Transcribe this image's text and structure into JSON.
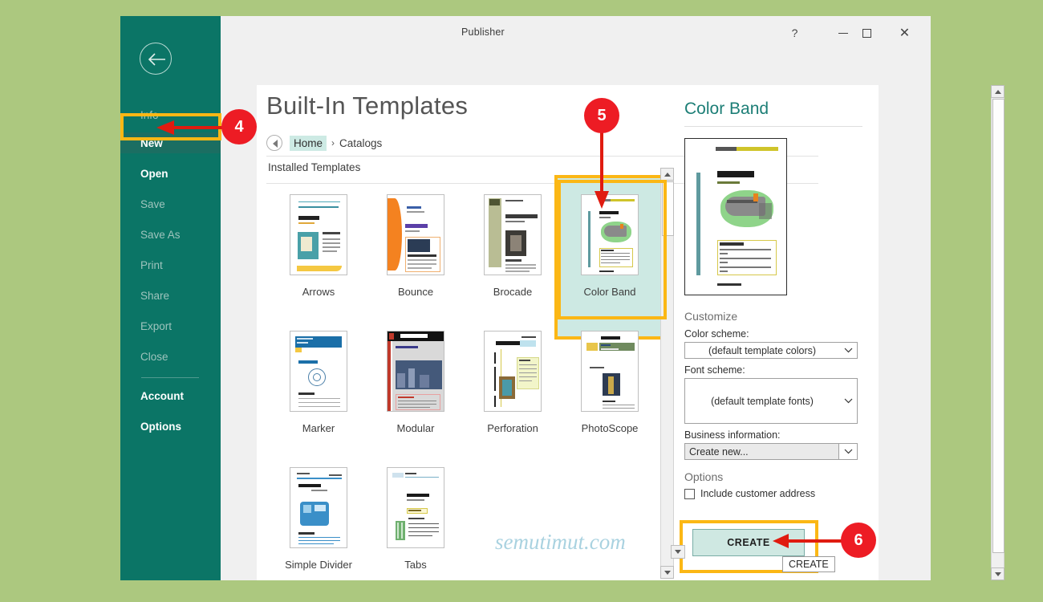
{
  "app": {
    "title": "Publisher",
    "background_color": "#acc87f",
    "accent_teal": "#0b7566",
    "highlight_yellow": "#fbb715",
    "callout_red": "#ed1c24"
  },
  "titlebar": {
    "title": "Publisher",
    "help_glyph": "?",
    "minimize_label": "minimize",
    "maximize_label": "maximize",
    "close_glyph": "✕"
  },
  "sidebar": {
    "back_label": "Back",
    "items": [
      {
        "label": "Info",
        "state": "dim"
      },
      {
        "label": "New",
        "state": "active"
      },
      {
        "label": "Open",
        "state": "bold"
      },
      {
        "label": "Save",
        "state": "dim"
      },
      {
        "label": "Save As",
        "state": "dim"
      },
      {
        "label": "Print",
        "state": "dim"
      },
      {
        "label": "Share",
        "state": "dim"
      },
      {
        "label": "Export",
        "state": "dim"
      },
      {
        "label": "Close",
        "state": "dim"
      },
      {
        "label": "Account",
        "state": "bold"
      },
      {
        "label": "Options",
        "state": "bold"
      }
    ]
  },
  "main": {
    "page_title": "Built-In Templates",
    "breadcrumb": {
      "home": "Home",
      "separator": "›",
      "current": "Catalogs"
    },
    "section_label": "Installed Templates",
    "templates": [
      {
        "name": "Arrows",
        "selected": false
      },
      {
        "name": "Bounce",
        "selected": false
      },
      {
        "name": "Brocade",
        "selected": false
      },
      {
        "name": "Color Band",
        "selected": true
      },
      {
        "name": "Marker",
        "selected": false
      },
      {
        "name": "Modular",
        "selected": false
      },
      {
        "name": "Perforation",
        "selected": false
      },
      {
        "name": "PhotoScope",
        "selected": false
      },
      {
        "name": "Simple Divider",
        "selected": false
      },
      {
        "name": "Tabs",
        "selected": false
      }
    ]
  },
  "preview": {
    "title": "Color Band",
    "customize_heading": "Customize",
    "color_scheme_label": "Color scheme:",
    "color_scheme_value": "(default template colors)",
    "font_scheme_label": "Font scheme:",
    "font_scheme_value": "(default template fonts)",
    "business_info_label": "Business information:",
    "business_info_value": "Create new...",
    "options_heading": "Options",
    "include_customer_address_label": "Include customer address",
    "include_customer_address_checked": false
  },
  "actions": {
    "create_label": "CREATE",
    "create_tooltip": "CREATE"
  },
  "callouts": [
    {
      "number": "4",
      "target": "sidebar-item-new"
    },
    {
      "number": "5",
      "target": "template-color-band"
    },
    {
      "number": "6",
      "target": "create-button"
    }
  ],
  "watermark": {
    "text": "semutimut.com"
  }
}
